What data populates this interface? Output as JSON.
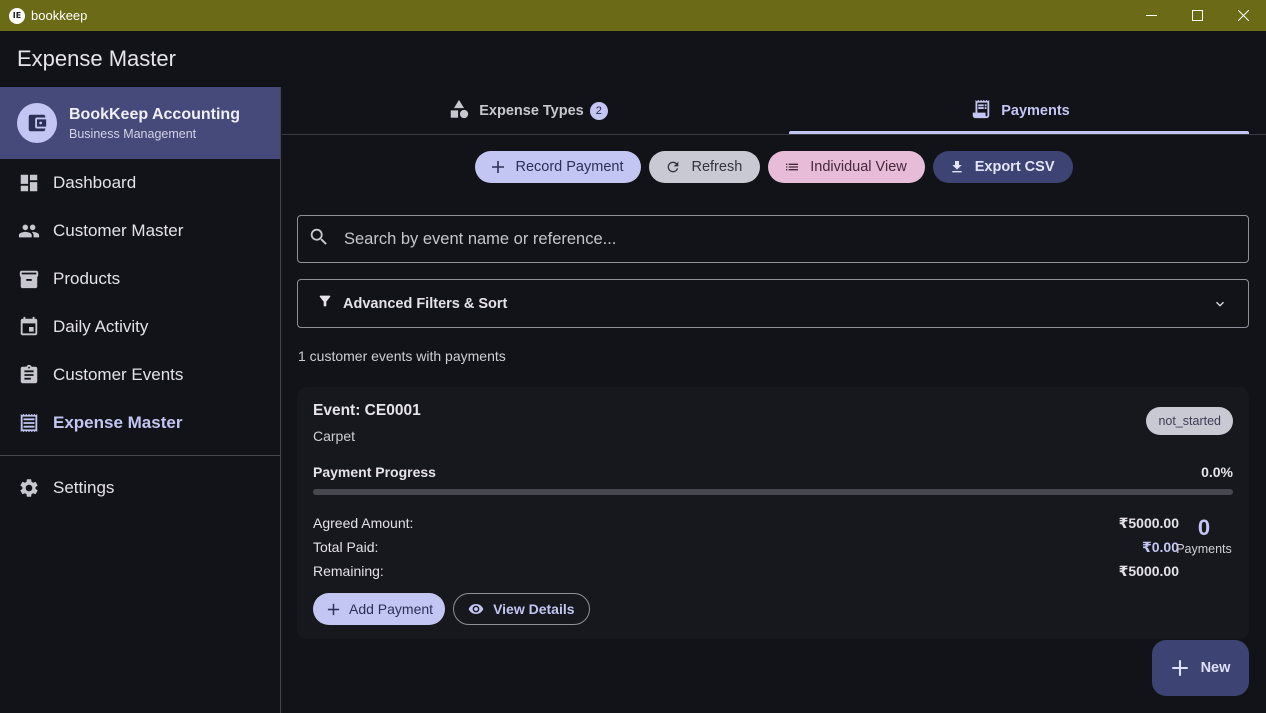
{
  "window": {
    "title": "bookkeep",
    "icon_text": "IE",
    "minimize": "─",
    "maximize": "☐",
    "close": "✕"
  },
  "appbar": {
    "title": "Expense Master"
  },
  "brand": {
    "name": "BookKeep Accounting",
    "subtitle": "Business Management",
    "icon": "wallet-icon"
  },
  "sidebar": {
    "items": [
      {
        "label": "Dashboard",
        "icon": "dashboard-icon",
        "active": false
      },
      {
        "label": "Customer Master",
        "icon": "people-icon",
        "active": false
      },
      {
        "label": "Products",
        "icon": "archive-icon",
        "active": false
      },
      {
        "label": "Daily Activity",
        "icon": "calendar-icon",
        "active": false
      },
      {
        "label": "Customer Events",
        "icon": "clipboard-icon",
        "active": false
      },
      {
        "label": "Expense Master",
        "icon": "receipt-icon",
        "active": true
      }
    ],
    "settings": {
      "label": "Settings",
      "icon": "gear-icon"
    }
  },
  "tabs": [
    {
      "label": "Expense Types",
      "badge": "2",
      "icon": "category-icon",
      "active": false
    },
    {
      "label": "Payments",
      "icon": "receipt-long-icon",
      "active": true
    }
  ],
  "toolbar": {
    "record": "Record Payment",
    "refresh": "Refresh",
    "individual": "Individual View",
    "export": "Export CSV"
  },
  "search": {
    "placeholder": "Search by event name or reference...",
    "value": ""
  },
  "filters": {
    "label": "Advanced Filters & Sort"
  },
  "summary": {
    "count_text": "1 customer events with payments"
  },
  "event": {
    "title": "Event: CE0001",
    "subtitle": "Carpet",
    "status": "not_started",
    "progress_label": "Payment Progress",
    "progress_text": "0.0%",
    "progress_value": 0,
    "agreed_label": "Agreed Amount:",
    "agreed_value": "₹5000.00",
    "paid_label": "Total Paid:",
    "paid_value": "₹0.00",
    "remaining_label": "Remaining:",
    "remaining_value": "₹5000.00",
    "payments_count": "0",
    "payments_label": "Payments",
    "add_payment": "Add Payment",
    "view_details": "View Details"
  },
  "fab": {
    "label": "New"
  },
  "colors": {
    "titlebar": "#6b6a17",
    "primary": "#c3c6f2",
    "brand_bg": "#454a7a",
    "surface": "#121318"
  }
}
